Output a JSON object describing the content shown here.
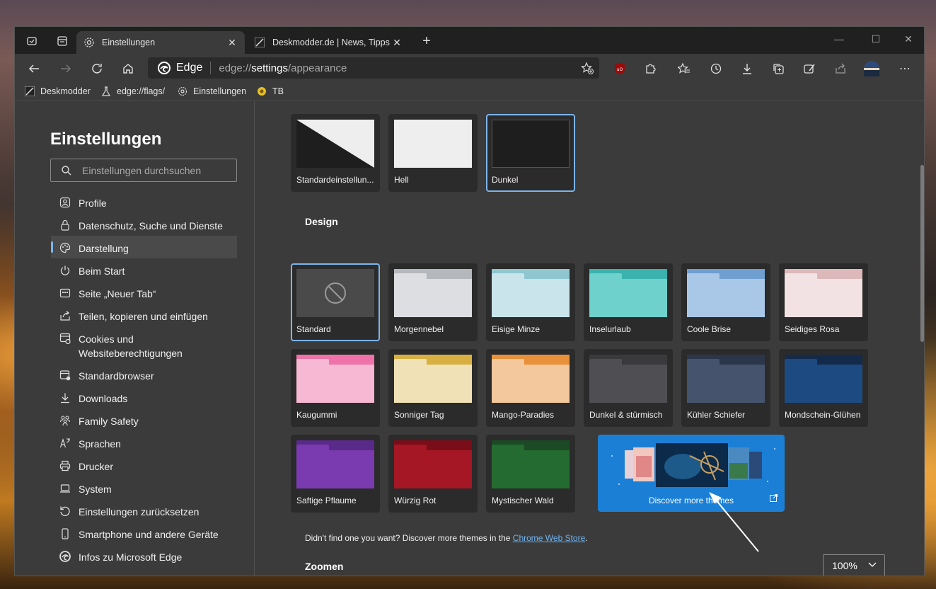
{
  "tabs": [
    {
      "label": "Einstellungen",
      "icon": "gear-icon",
      "active": true
    },
    {
      "label": "Deskmodder.de | News, Tipps und",
      "icon": "deskmodder-icon",
      "active": false
    }
  ],
  "toolbar": {
    "site_name": "Edge",
    "url_prefix": "edge://",
    "url_main": "settings",
    "url_rest": "/appearance"
  },
  "bookmarks": [
    {
      "label": "Deskmodder",
      "icon": "deskmodder-icon"
    },
    {
      "label": "edge://flags/",
      "icon": "flask-icon"
    },
    {
      "label": "Einstellungen",
      "icon": "gear-icon"
    },
    {
      "label": "TB",
      "icon": "tb-icon"
    }
  ],
  "sidebar": {
    "title": "Einstellungen",
    "search_placeholder": "Einstellungen durchsuchen",
    "items": [
      {
        "label": "Profile",
        "icon": "profile-icon"
      },
      {
        "label": "Datenschutz, Suche und Dienste",
        "icon": "lock-icon"
      },
      {
        "label": "Darstellung",
        "icon": "palette-icon",
        "active": true
      },
      {
        "label": "Beim Start",
        "icon": "power-icon"
      },
      {
        "label": "Seite „Neuer Tab“",
        "icon": "newtab-icon"
      },
      {
        "label": "Teilen, kopieren und einfügen",
        "icon": "share-icon"
      },
      {
        "label": "Cookies und Websiteberechtigungen",
        "icon": "cookies-icon"
      },
      {
        "label": "Standardbrowser",
        "icon": "browser-icon"
      },
      {
        "label": "Downloads",
        "icon": "download-icon"
      },
      {
        "label": "Family Safety",
        "icon": "family-icon"
      },
      {
        "label": "Sprachen",
        "icon": "language-icon"
      },
      {
        "label": "Drucker",
        "icon": "printer-icon"
      },
      {
        "label": "System",
        "icon": "laptop-icon"
      },
      {
        "label": "Einstellungen zurücksetzen",
        "icon": "reset-icon"
      },
      {
        "label": "Smartphone und andere Geräte",
        "icon": "phone-icon"
      },
      {
        "label": "Infos zu Microsoft Edge",
        "icon": "edge-icon"
      }
    ]
  },
  "appearance": {
    "modes": [
      {
        "label": "Standardeinstellun...",
        "style": "split"
      },
      {
        "label": "Hell",
        "style": "light"
      },
      {
        "label": "Dunkel",
        "style": "dark",
        "selected": true
      }
    ],
    "design_heading": "Design",
    "themes": [
      {
        "label": "Standard",
        "tab": "#4a4a4a",
        "front": "#4a4a4a",
        "selected": true,
        "kind": "none"
      },
      {
        "label": "Morgennebel",
        "tab": "#b4b7bc",
        "front": "#dcdee2"
      },
      {
        "label": "Eisige Minze",
        "tab": "#8fc6d0",
        "front": "#c9e4ea"
      },
      {
        "label": "Inselurlaub",
        "tab": "#3bb2ad",
        "front": "#6fd1cc"
      },
      {
        "label": "Coole Brise",
        "tab": "#6f9ed0",
        "front": "#a9c7e6"
      },
      {
        "label": "Seidiges Rosa",
        "tab": "#dcb8bb",
        "front": "#f2e2e3"
      },
      {
        "label": "Kaugummi",
        "tab": "#ef73a8",
        "front": "#f6b8d2"
      },
      {
        "label": "Sonniger Tag",
        "tab": "#d8b042",
        "front": "#f0e2b6"
      },
      {
        "label": "Mango-Paradies",
        "tab": "#e8913a",
        "front": "#f2c89c"
      },
      {
        "label": "Dunkel & stürmisch",
        "tab": "#3a3a3d",
        "front": "#4f4f53"
      },
      {
        "label": "Kühler Schiefer",
        "tab": "#2c364a",
        "front": "#46536c"
      },
      {
        "label": "Mondschein-Glühen",
        "tab": "#142a4a",
        "front": "#1d4a80"
      },
      {
        "label": "Saftige Pflaume",
        "tab": "#5a2a8a",
        "front": "#7a3ab0"
      },
      {
        "label": "Würzig Rot",
        "tab": "#7a0e18",
        "front": "#a51724"
      },
      {
        "label": "Mystischer Wald",
        "tab": "#1b4a24",
        "front": "#236b30"
      }
    ],
    "discover_label": "Discover more themes",
    "hint_text": "Didn't find one you want? Discover more themes in the ",
    "hint_link": "Chrome Web Store",
    "hint_end": ".",
    "zoom_heading": "Zoomen",
    "zoom_value": "100%"
  },
  "colors": {
    "accent": "#7cb5ec",
    "discover_bg": "#1b7fd6"
  }
}
